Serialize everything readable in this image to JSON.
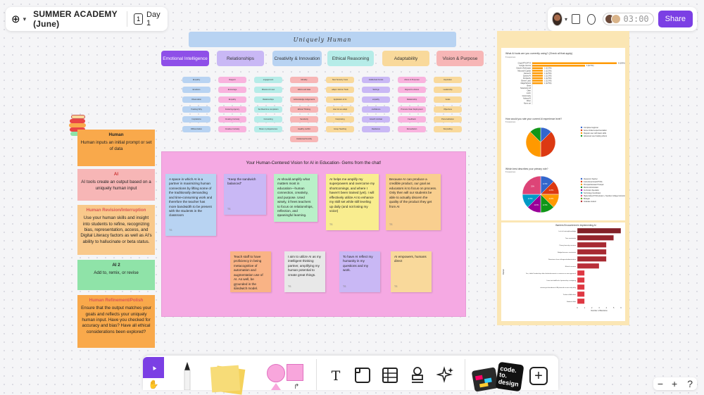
{
  "header": {
    "board_title": "SUMMER ACADEMY (June)",
    "day_icon": "1",
    "day_label": "Day 1",
    "timer": "03:00",
    "share": "Share"
  },
  "board": {
    "banner": "Uniquely Human",
    "categories": [
      {
        "label": "Emotional Intelligence",
        "color": "#8e4fe8",
        "text": "#ffffff"
      },
      {
        "label": "Relationships",
        "color": "#c9b8f5",
        "text": "#333333"
      },
      {
        "label": "Creativity & Innovation",
        "color": "#b8d3f2",
        "text": "#333333"
      },
      {
        "label": "Ethical Reasoning",
        "color": "#b6ece8",
        "text": "#333333"
      },
      {
        "label": "Adaptability",
        "color": "#f9d99b",
        "text": "#333333"
      },
      {
        "label": "Vision & Purpose",
        "color": "#f7b6b6",
        "text": "#333333"
      }
    ],
    "chip_columns": [
      {
        "color": "#b8d3f2",
        "chips": [
          "Empathy",
          "Emotions",
          "Observation",
          "Tracking Why",
          "Inspirations",
          "Differentiation"
        ]
      },
      {
        "color": "#f9b3de",
        "chips": [
          "Rapport",
          "Encourage",
          "Empathy",
          "Fostering Agency",
          "Creating Curiosity",
          "Creative Curiosity"
        ]
      },
      {
        "color": "#b6ece8",
        "chips": [
          "engagement",
          "Mission Art new",
          "Relationships",
          "Set Real time completion",
          "Connecting",
          "Share my Experiences"
        ]
      },
      {
        "color": "#f7b6b6",
        "chips": [
          "Morality",
          "Ethics and data",
          "Acknowledge Judgements",
          "Ethical Thinking",
          "Sensitivity",
          "Healthy conflict",
          "Intellectual humility"
        ]
      },
      {
        "color": "#f9d99b",
        "chips": [
          "New Sensory Cues",
          "adapt / Add on Tools",
          "Application of AI",
          "How do we adapt",
          "Interpreting",
          "Group Teaching"
        ]
      },
      {
        "color": "#c9b8f5",
        "chips": [
          "Intellectual Curios",
          "Settings",
          "empathy",
          "confidence",
          "Growth mindset",
          "Resilience"
        ]
      },
      {
        "color": "#f9b3de",
        "chips": [
          "Above & Purposes",
          "Aligned to visions",
          "Relationship",
          "Promote Clear Deployment",
          "Feedback",
          "Remediation"
        ]
      },
      {
        "color": "#f9d99b",
        "chips": [
          "Inspiration",
          "Leadership",
          "Goals",
          "Objectives",
          "Personalization",
          "Storytelling"
        ]
      }
    ],
    "stack": [
      {
        "title": "Human",
        "text": "Human inputs an initial prompt or set of data",
        "color": "#f9a94b"
      },
      {
        "title": "AI",
        "text": "AI tools create an output based on a uniquely human input",
        "color": "#f7b6b6"
      },
      {
        "title": "Human Revision/Interruption",
        "text": "Use your human skills and insight into students to refine, recognizing bias, representation, access, and Digital Literacy factors as well as AI's ability to hallucinate or beta status.",
        "color": "#f9c98b"
      },
      {
        "title": "AI 2",
        "text": "Add to, remix, or revise",
        "color": "#8fe3a8"
      },
      {
        "title": "Human Refinement/Polish",
        "text": "Ensure that the output matches your goals and reflects your uniquely human input. Have you checked for accuracy and bias? Have all ethical considerations been explored?",
        "color": "#f9a94b"
      }
    ],
    "vision": {
      "title": "Your Human-Centered Vision for AI in Education- Gems from the chat!",
      "notes": [
        {
          "text": "A space in which AI is a partner in maximizing human connections by lifting some of the traditionally demanding and time-consuming work and therefore the teacher has more bandwidth to be present with the students in the classroom",
          "color": "#b8d3f2",
          "footer": "TS"
        },
        {
          "text": "\"Keep the sandwich balanced\"",
          "color": "#c9b8f5",
          "footer": "TS"
        },
        {
          "text": "AI should amplify what matters most in education—human connection, creativity, and purpose. Used wisely, it frees teachers to focus on relationships, reflection, and meaningful learning.",
          "color": "#b9f0c8",
          "footer": "TS"
        },
        {
          "text": "AI helps me amplify my superpowers and overcome my shortcomings, and where I haven't been trained (yet). I will effectively utilize AI to enhance my skill set while still leveling up daily (and not losing my voice)",
          "color": "#f9ed8f",
          "footer": "TS"
        },
        {
          "text": "Because AI can produce a credible product, our goal as educators is to focus on process. Only then will our students be able to actually discern the quality of the product they get from AI",
          "color": "#f9cf8f",
          "footer": "TS"
        },
        {
          "text": "Teach staff to have proficiency in being metacognitive of automation and augmentation use of AI. As well, be grounded in the sandwich model.",
          "color": "#f9b385",
          "footer": "TS"
        },
        {
          "text": "I aim to utilize AI as my intelligent thinking partner, amplifying my human potential to create great things.",
          "color": "#e8e8e8",
          "footer": "TS"
        },
        {
          "text": "To have AI reflect my humanity in my questions and my work.",
          "color": "#c9b8f5",
          "footer": "TS"
        },
        {
          "text": "AI empowers, humans direct",
          "color": "#f9d99b",
          "footer": "TS"
        }
      ]
    },
    "survey": {
      "q1": "What AI tools are you currently using? (Check all that apply)",
      "q1_sub": "8 responses",
      "q1_tools": [
        "ChatGPT/GPT-4",
        "Google Gemini",
        "Claude (Anthropic)",
        "Microsoft Copilot",
        "Canva AI",
        "Quizizz AI",
        "Perplexity",
        "Eleven Labs",
        "MagicSchool",
        "Brisk",
        "Notebook LM",
        "Otter",
        "Loom",
        "Grammarly",
        "Kahoot AI",
        "Other",
        "None yet"
      ],
      "q1_values": [
        8,
        5,
        1,
        1,
        1,
        1,
        1,
        1,
        1,
        0,
        0,
        0,
        0,
        0,
        0,
        0,
        0
      ],
      "q1_labels": [
        "8 (100%)",
        "5 (62.5%)",
        "1 (12.5%)",
        "1 (12.5%)",
        "1 (12.5%)",
        "1 (12.5%)",
        "1 (12.5%)",
        "1 (12.5%)",
        "1 (12.5%)",
        "",
        "",
        "",
        "",
        "",
        "",
        "",
        ""
      ],
      "q2": "How would you rate your current AI experience level?",
      "q2_sub": "8 responses",
      "q2_legend": [
        "Complete beginner",
        "Some limited experimentation",
        "Regular user with basic skills",
        "Advanced user helping others"
      ],
      "q2_values": [
        12.5,
        37.5,
        37.5,
        12.5
      ],
      "q2_colors": [
        "#3366cc",
        "#dc3912",
        "#ff9900",
        "#109618"
      ],
      "q3": "Which best describes your primary role?",
      "q3_sub": "8 responses",
      "q3_legend": [
        "Classroom Teacher",
        "Instructional Coach/TOSA",
        "Principal/Assistant Principal",
        "District Administrator",
        "Curriculum Specialist",
        "Technology Coordinator",
        "Higher Ed/ed-TOSA student + Teachers College Instructor",
        "Biologist",
        "Graduate student"
      ],
      "q3_values": [
        12.5,
        12.5,
        12.5,
        12.5,
        12.5,
        12.5,
        25
      ],
      "q3_colors": [
        "#3366cc",
        "#dc3912",
        "#ff9900",
        "#109618",
        "#990099",
        "#0099c6",
        "#dd4477",
        "#66aa00",
        "#b82e2e"
      ],
      "q3_slice_labels": [
        "12.5%",
        "12.5%",
        "12.5%",
        "12.5%",
        "12.5%",
        "12.5%",
        "25%"
      ],
      "barriers_title": "Barriers Encountered in Implementing AI",
      "barriers_ylabel": "Barrier",
      "barriers_xlabel": "Number of Mentions",
      "barriers": [
        "Lack of training/knowledge",
        "Time constraints",
        "Privacy/security concerns",
        "Budget/resource constraints",
        "Resistance from colleagues/administration",
        "Ethical concerns",
        "Yes, it didn't leadership either that/enforcement or concerns on new approach",
        "It was too bold/lack of partnership in adopting",
        "returning to boundaries & AI planned access and policy",
        "Technical difficulties",
        "Student follow"
      ],
      "barrier_values": [
        6,
        5,
        4,
        4,
        4,
        3,
        1,
        1,
        1,
        1,
        1
      ],
      "barrier_ticks": [
        "0",
        "1",
        "2",
        "3",
        "4",
        "5",
        "6"
      ]
    }
  },
  "toolbar": {
    "pointer": "▲",
    "hand": "✋",
    "text_tool": "T",
    "sticker_card_1": "code.",
    "sticker_card_2": "to.",
    "sticker_card_3": "design",
    "add": "+"
  },
  "zoom": {
    "minus": "−",
    "plus": "+",
    "help": "?"
  }
}
